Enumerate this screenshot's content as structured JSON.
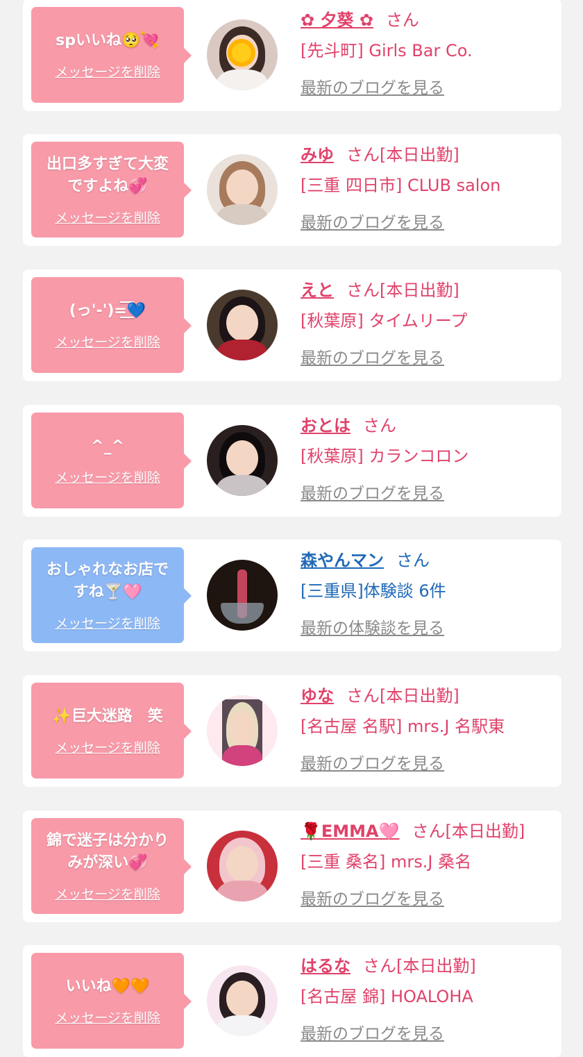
{
  "items": [
    {
      "message": "spいいね🥺💘",
      "delete_label": "メッセージを削除",
      "bubble_color": "#f99aa9",
      "name": "✿ 夕葵 ✿",
      "honorific": "さん",
      "status": "",
      "shop": "[先斗町] Girls Bar Co.",
      "link": "最新のブログを見る",
      "text_color": "#e0426a",
      "avatar_tone": "light"
    },
    {
      "message": "出口多すぎて大変ですよね💞",
      "delete_label": "メッセージを削除",
      "bubble_color": "#f99aa9",
      "name": "みゆ",
      "honorific": "さん",
      "status": "[本日出勤]",
      "shop": "[三重 四日市] CLUB salon",
      "link": "最新のブログを見る",
      "text_color": "#e0426a",
      "avatar_tone": "beige"
    },
    {
      "message": "(っ'-')=͟͟͞͞💙",
      "delete_label": "メッセージを削除",
      "bubble_color": "#f99aa9",
      "name": "えと",
      "honorific": "さん",
      "status": "[本日出勤]",
      "shop": "[秋葉原] タイムリープ",
      "link": "最新のブログを見る",
      "text_color": "#e0426a",
      "avatar_tone": "dark-red"
    },
    {
      "message": "^_^",
      "delete_label": "メッセージを削除",
      "bubble_color": "#f99aa9",
      "name": "おとは",
      "honorific": "さん",
      "status": "",
      "shop": "[秋葉原] カランコロン",
      "link": "最新のブログを見る",
      "text_color": "#e0426a",
      "avatar_tone": "dark"
    },
    {
      "message": "おしゃれなお店ですね🍸🩷",
      "delete_label": "メッセージを削除",
      "bubble_color": "#8db8f6",
      "name": "森やんマン",
      "honorific": "さん",
      "status": "",
      "shop": "[三重県]体験談 6件",
      "link": "最新の体験談を見る",
      "text_color": "#1f69b6",
      "avatar_tone": "bottle"
    },
    {
      "message": "✨巨大迷路　笑",
      "delete_label": "メッセージを削除",
      "bubble_color": "#f99aa9",
      "name": "ゆな",
      "honorific": "さん",
      "status": "[本日出勤]",
      "shop": "[名古屋 名駅] mrs.J 名駅東",
      "link": "最新のブログを見る",
      "text_color": "#e0426a",
      "avatar_tone": "pink-light"
    },
    {
      "message": "錦で迷子は分かりみが深い💞",
      "delete_label": "メッセージを削除",
      "bubble_color": "#f99aa9",
      "name": "🌹EMMA🩷",
      "honorific": "さん",
      "status": "[本日出勤]",
      "shop": "[三重 桑名] mrs.J 桑名",
      "link": "最新のブログを見る",
      "text_color": "#e0426a",
      "avatar_tone": "red"
    },
    {
      "message": "いいね🧡🧡",
      "delete_label": "メッセージを削除",
      "bubble_color": "#f99aa9",
      "name": "はるな",
      "honorific": "さん",
      "status": "[本日出勤]",
      "shop": "[名古屋 錦] HOALOHA",
      "link": "最新のブログを見る",
      "text_color": "#e0426a",
      "avatar_tone": "pastel"
    }
  ]
}
